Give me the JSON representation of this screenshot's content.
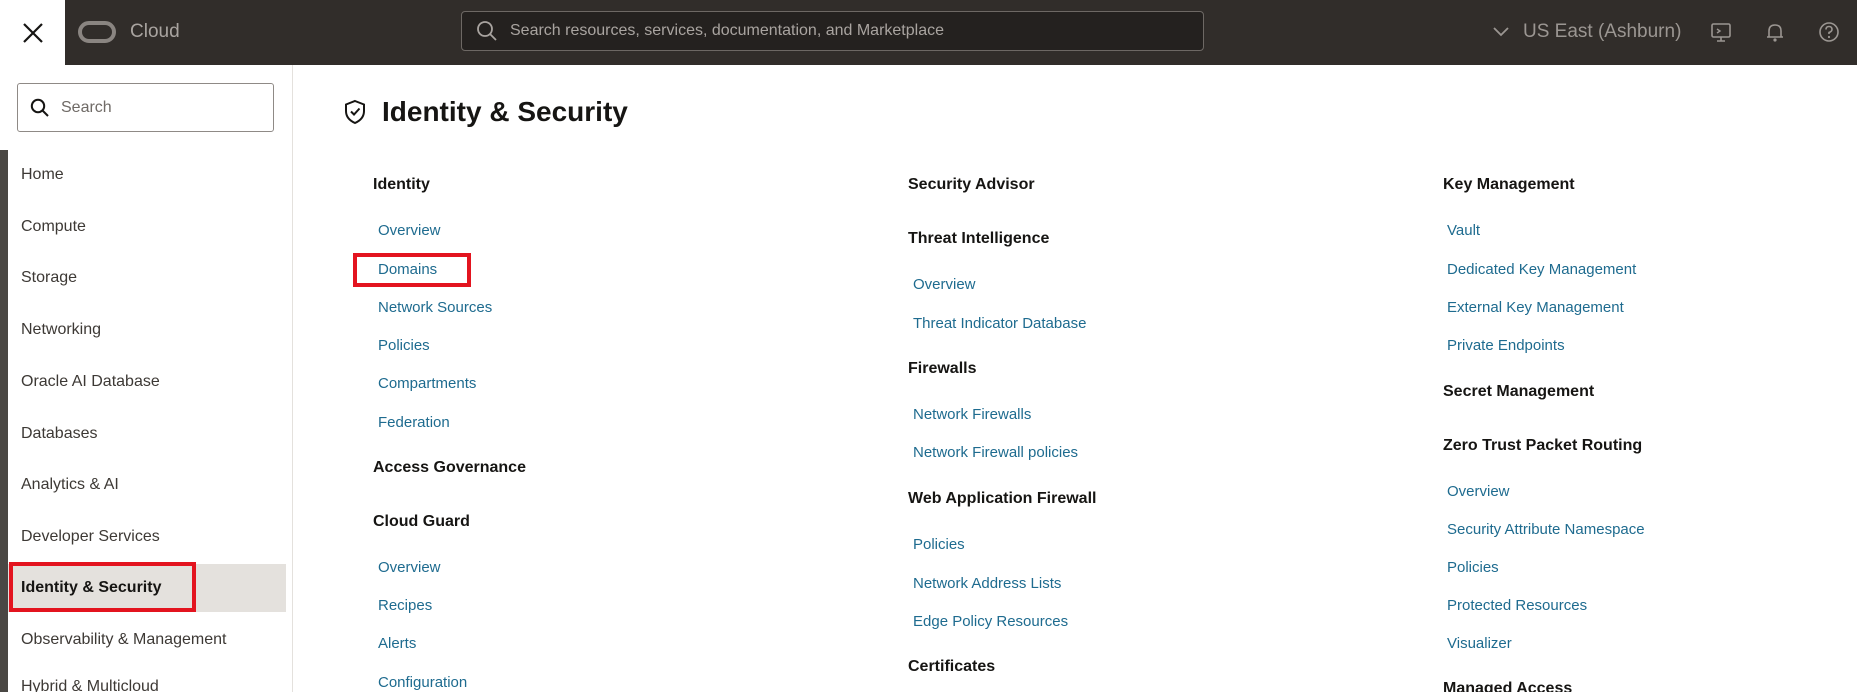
{
  "topbar": {
    "brand": "Cloud",
    "search_placeholder": "Search resources, services, documentation, and Marketplace",
    "region": "US East (Ashburn)",
    "icons": [
      "close-icon",
      "oracle-logo-icon",
      "search-icon",
      "chevron-down-icon",
      "cloud-shell-icon",
      "bell-icon",
      "help-icon"
    ]
  },
  "sidebar": {
    "search_placeholder": "Search",
    "items": [
      {
        "label": "Home"
      },
      {
        "label": "Compute"
      },
      {
        "label": "Storage"
      },
      {
        "label": "Networking"
      },
      {
        "label": "Oracle AI Database"
      },
      {
        "label": "Databases"
      },
      {
        "label": "Analytics & AI"
      },
      {
        "label": "Developer Services"
      },
      {
        "label": "Identity & Security",
        "active": true
      },
      {
        "label": "Observability & Management"
      },
      {
        "label": "Hybrid & Multicloud"
      }
    ]
  },
  "main": {
    "title": "Identity & Security",
    "columns": [
      {
        "sections": [
          {
            "heading": "Identity",
            "links": [
              "Overview",
              "Domains",
              "Network Sources",
              "Policies",
              "Compartments",
              "Federation"
            ]
          },
          {
            "heading": "Access Governance",
            "links": []
          },
          {
            "heading": "Cloud Guard",
            "links": [
              "Overview",
              "Recipes",
              "Alerts",
              "Configuration"
            ]
          }
        ]
      },
      {
        "sections": [
          {
            "heading": "Security Advisor",
            "links": []
          },
          {
            "heading": "Threat Intelligence",
            "links": [
              "Overview",
              "Threat Indicator Database"
            ]
          },
          {
            "heading": "Firewalls",
            "links": [
              "Network Firewalls",
              "Network Firewall policies"
            ]
          },
          {
            "heading": "Web Application Firewall",
            "links": [
              "Policies",
              "Network Address Lists",
              "Edge Policy Resources"
            ]
          },
          {
            "heading": "Certificates",
            "links": []
          }
        ]
      },
      {
        "sections": [
          {
            "heading": "Key Management",
            "links": [
              "Vault",
              "Dedicated Key Management",
              "External Key Management",
              "Private Endpoints"
            ]
          },
          {
            "heading": "Secret Management",
            "links": []
          },
          {
            "heading": "Zero Trust Packet Routing",
            "links": [
              "Overview",
              "Security Attribute Namespace",
              "Policies",
              "Protected Resources",
              "Visualizer"
            ]
          },
          {
            "heading": "Managed Access",
            "links": []
          }
        ]
      }
    ]
  },
  "colors": {
    "topbar": "#312d2a",
    "link": "#1e6b8f",
    "highlight": "#e3141f",
    "active_nav": "#e4e1dd"
  }
}
